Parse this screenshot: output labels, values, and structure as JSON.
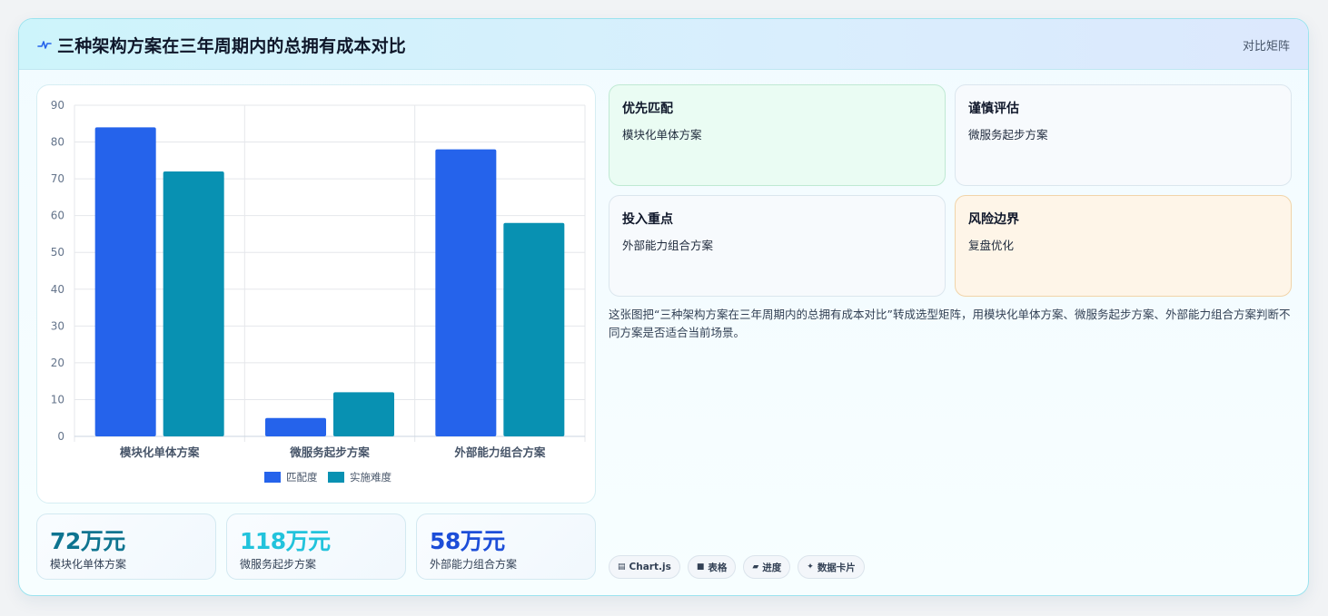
{
  "header": {
    "title": "三种架构方案在三年周期内的总拥有成本对比",
    "badge": "对比矩阵",
    "icon": "pulse-icon"
  },
  "chart_data": {
    "type": "bar",
    "categories": [
      "模块化单体方案",
      "微服务起步方案",
      "外部能力组合方案"
    ],
    "series": [
      {
        "name": "匹配度",
        "values": [
          84,
          5,
          78
        ],
        "color": "#2563eb"
      },
      {
        "name": "实施难度",
        "values": [
          72,
          12,
          58
        ],
        "color": "#0891b2"
      }
    ],
    "title": "",
    "xlabel": "",
    "ylabel": "",
    "ylim": [
      0,
      90
    ],
    "yticks": [
      0,
      10,
      20,
      30,
      40,
      50,
      60,
      70,
      80,
      90
    ],
    "grid": true,
    "legend_position": "bottom"
  },
  "stats": [
    {
      "value": "72万元",
      "label": "模块化单体方案",
      "color": "#0e7490"
    },
    {
      "value": "118万元",
      "label": "微服务起步方案",
      "color": "#22c3dc"
    },
    {
      "value": "58万元",
      "label": "外部能力组合方案",
      "color": "#1d4ed8"
    }
  ],
  "quadrants": [
    {
      "title": "优先匹配",
      "text": "模块化单体方案"
    },
    {
      "title": "谨慎评估",
      "text": "微服务起步方案"
    },
    {
      "title": "投入重点",
      "text": "外部能力组合方案"
    },
    {
      "title": "风险边界",
      "text": "复盘优化"
    }
  ],
  "description": "这张图把“三种架构方案在三年周期内的总拥有成本对比”转成选型矩阵，用模块化单体方案、微服务起步方案、外部能力组合方案判断不同方案是否适合当前场景。",
  "tags": [
    {
      "icon": "▤",
      "label": "Chart.js"
    },
    {
      "icon": "■",
      "label": "表格"
    },
    {
      "icon": "▰",
      "label": "进度"
    },
    {
      "icon": "✦",
      "label": "数据卡片"
    }
  ]
}
